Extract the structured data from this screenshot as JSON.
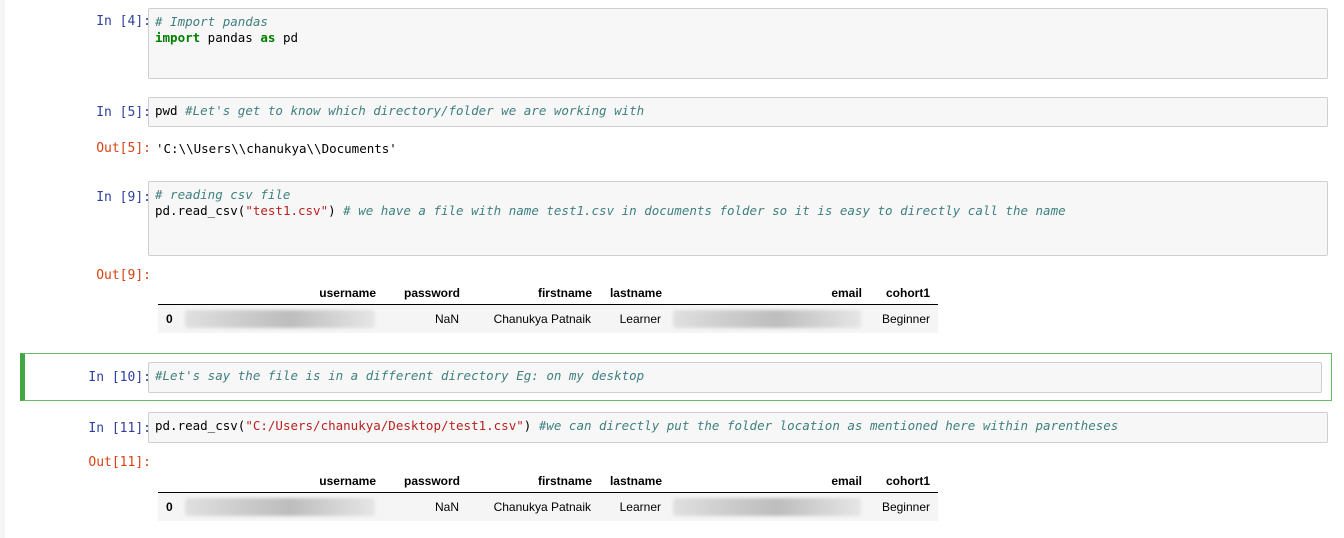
{
  "cells": [
    {
      "in_prompt": "In [4]:",
      "code_lines": [
        [
          {
            "t": "cm",
            "v": "# Import pandas"
          }
        ],
        [
          {
            "t": "kw",
            "v": "import"
          },
          {
            "t": "",
            "v": " pandas "
          },
          {
            "t": "kw",
            "v": "as"
          },
          {
            "t": "",
            "v": " pd"
          }
        ]
      ]
    },
    {
      "in_prompt": "In [5]:",
      "code_lines": [
        [
          {
            "t": "",
            "v": "pwd "
          },
          {
            "t": "cm",
            "v": "#Let's get to know which directory/folder we are working with"
          }
        ]
      ],
      "out_prompt": "Out[5]:",
      "output_text": "'C:\\\\Users\\\\chanukya\\\\Documents'"
    },
    {
      "in_prompt": "In [9]:",
      "code_lines": [
        [
          {
            "t": "cm",
            "v": "# reading csv file"
          }
        ],
        [
          {
            "t": "",
            "v": "pd.read_csv("
          },
          {
            "t": "str",
            "v": "\"test1.csv\""
          },
          {
            "t": "",
            "v": ") "
          },
          {
            "t": "cm",
            "v": "# we have a file with name test1.csv in documents folder so it is easy to directly call the name"
          }
        ]
      ],
      "out_prompt": "Out[9]:"
    },
    {
      "in_prompt": "In [10]:",
      "code_lines": [
        [
          {
            "t": "cm",
            "v": "#Let's say the file is in a different directory Eg: on my desktop"
          }
        ]
      ]
    },
    {
      "in_prompt": "In [11]:",
      "code_lines": [
        [
          {
            "t": "",
            "v": "pd.read_csv("
          },
          {
            "t": "str",
            "v": "\"C:/Users/chanukya/Desktop/test1.csv\""
          },
          {
            "t": "",
            "v": ") "
          },
          {
            "t": "cm",
            "v": "#we can directly put the folder location as mentioned here within parentheses"
          }
        ]
      ],
      "out_prompt": "Out[11]:"
    }
  ],
  "dataframe": {
    "columns": [
      "username",
      "password",
      "firstname",
      "lastname",
      "email",
      "cohort1"
    ],
    "rows": [
      {
        "index": "0",
        "password": "NaN",
        "firstname": "Chanukya Patnaik",
        "lastname": "Learner",
        "cohort1": "Beginner"
      }
    ]
  },
  "colors": {
    "in_prompt": "#303f9f",
    "out_prompt": "#d84315",
    "comment": "#408080",
    "keyword": "#008000",
    "string": "#ba2121",
    "selected_border": "#42a645"
  }
}
